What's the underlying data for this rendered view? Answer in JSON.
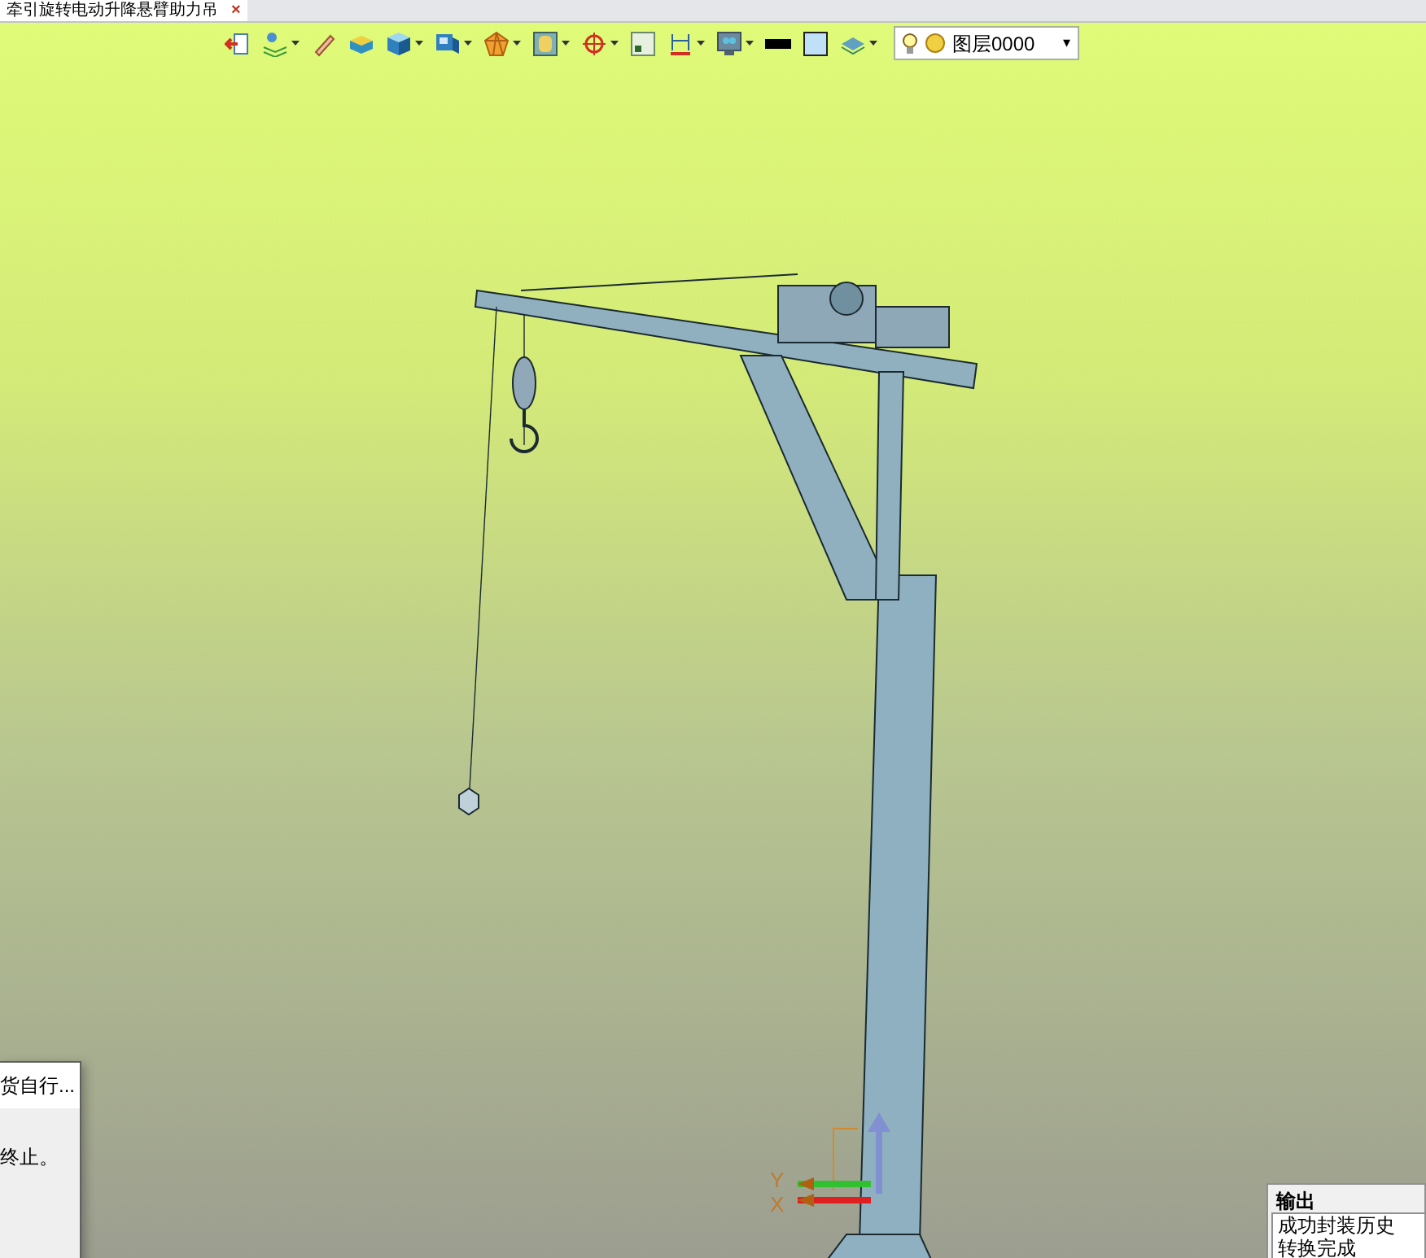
{
  "tab": {
    "title": "牵引旋转电动升降悬臂助力吊",
    "close": "×",
    "selected": true
  },
  "toolbar": {
    "tools": [
      {
        "kind": "exit",
        "dropdown": false
      },
      {
        "kind": "layers",
        "dropdown": true
      },
      {
        "kind": "pen",
        "dropdown": false
      },
      {
        "kind": "slab",
        "dropdown": false
      },
      {
        "kind": "cube",
        "dropdown": true
      },
      {
        "kind": "view",
        "dropdown": true
      },
      {
        "kind": "polygon",
        "dropdown": true
      },
      {
        "kind": "frame",
        "dropdown": true
      },
      {
        "kind": "target",
        "dropdown": true
      },
      {
        "kind": "window",
        "dropdown": false
      },
      {
        "kind": "dimension",
        "dropdown": true
      },
      {
        "kind": "monitor",
        "dropdown": true
      },
      {
        "kind": "line",
        "dropdown": false
      },
      {
        "kind": "fill",
        "dropdown": false
      },
      {
        "kind": "stack",
        "dropdown": true
      }
    ],
    "layer": {
      "name": "图层0000",
      "caret": "▾",
      "on": true
    }
  },
  "axis_labels": [
    "Y",
    "X"
  ],
  "dialog": {
    "title": "货自行...",
    "message": "终止。"
  },
  "output": {
    "title": "输出",
    "lines": [
      "成功封装历史",
      "转换完成"
    ]
  }
}
